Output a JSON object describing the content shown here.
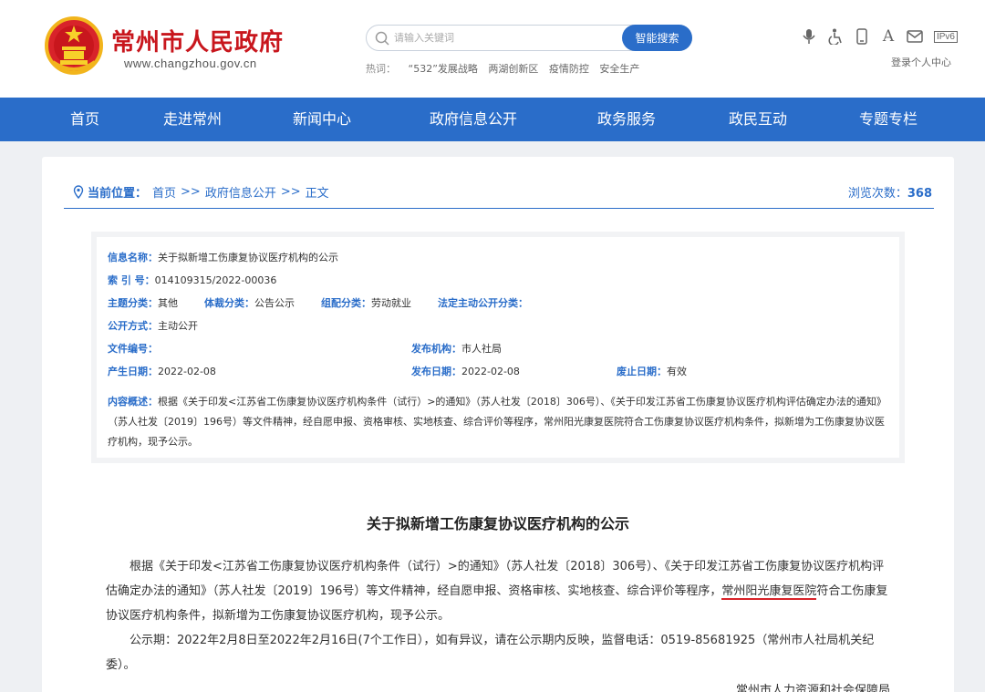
{
  "header": {
    "site_title": "常州市人民政府",
    "site_url": "www.changzhou.gov.cn",
    "search_placeholder": "请输入关键词",
    "search_button": "智能搜索",
    "hot_label": "热词：",
    "hot_words": [
      "“532”发展战略",
      "两湖创新区",
      "疫情防控",
      "安全生产"
    ],
    "login": "登录个人中心",
    "tools": [
      "voice-icon",
      "accessibility-icon",
      "mobile-icon",
      "font-size-icon",
      "mail-icon",
      "ipv6-icon"
    ],
    "ipv6_text": "IPv6",
    "font_glyph": "A"
  },
  "nav": {
    "items": [
      "首页",
      "走进常州",
      "新闻中心",
      "政府信息公开",
      "政务服务",
      "政民互动",
      "专题专栏"
    ]
  },
  "breadcrumb": {
    "label": "当前位置：",
    "items": [
      "首页",
      "政府信息公开",
      "正文"
    ],
    "sep": ">>",
    "views_label": "浏览次数：",
    "views": "368"
  },
  "meta": {
    "info_name_k": "信息名称：",
    "info_name_v": "关于拟新增工伤康复协议医疗机构的公示",
    "index_k": "索 引 号：",
    "index_v": "014109315/2022-00036",
    "topic_k": "主题分类：",
    "topic_v": "其他",
    "genre_k": "体裁分类：",
    "genre_v": "公告公示",
    "org_cat_k": "组配分类：",
    "org_cat_v": "劳动就业",
    "legal_k": "法定主动公开分类：",
    "legal_v": "",
    "mode_k": "公开方式：",
    "mode_v": "主动公开",
    "doc_no_k": "文件编号：",
    "doc_no_v": "",
    "publisher_k": "发布机构：",
    "publisher_v": "市人社局",
    "created_k": "产生日期：",
    "created_v": "2022-02-08",
    "published_k": "发布日期：",
    "published_v": "2022-02-08",
    "expire_k": "废止日期：",
    "expire_v": "有效",
    "summary_k": "内容概述：",
    "summary_v": "根据《关于印发<江苏省工伤康复协议医疗机构条件（试行）>的通知》（苏人社发〔2018〕306号）、《关于印发江苏省工伤康复协议医疗机构评估确定办法的通知》（苏人社发〔2019〕196号）等文件精神，经自愿申报、资格审核、实地核查、综合评价等程序，常州阳光康复医院符合工伤康复协议医疗机构条件，拟新增为工伤康复协议医疗机构，现予公示。"
  },
  "article": {
    "title": "关于拟新增工伤康复协议医疗机构的公示",
    "p1_a": "根据《关于印发<江苏省工伤康复协议医疗机构条件（试行）>的通知》（苏人社发〔2018〕306号）、《关于印发江苏省工伤康复协议医疗机构评估确定办法的通知》（苏人社发〔2019〕196号）等文件精神，经自愿申报、资格审核、实地核查、综合评价等程序，",
    "p1_hl": "常州阳光康复医院",
    "p1_b": "符合工伤康复协议医疗机构条件，拟新增为工伤康复协议医疗机构，现予公示。",
    "p2": "公示期：2022年2月8日至2022年2月16日(7个工作日），如有异议，请在公示期内反映，监督电话：0519-85681925（常州市人社局机关纪委）。",
    "signature": "常州市人力资源和社会保障局"
  }
}
